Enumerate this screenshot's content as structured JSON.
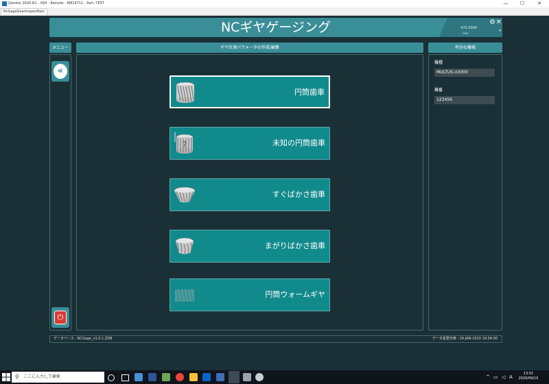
{
  "window": {
    "title": "Qandos 2020.R1 - X64 - Remote - RM14711 - Part: TEST",
    "tab": "NcGageGearInspecMain",
    "min": "—",
    "max": "☐",
    "close": "✕"
  },
  "header": {
    "title": "NCギヤゲージング",
    "value": "472.0000",
    "user": "User",
    "gear_glyph": "⚙",
    "close_glyph": "✕",
    "caret": "▾"
  },
  "menu": {
    "title": "メニュー",
    "back_glyph": "«",
    "exit_glyph": "⏻"
  },
  "main": {
    "title": "ギヤ計測パラメータの作成/編集",
    "buttons": [
      {
        "label": "円筒歯車",
        "icon": "cylindrical-gear-icon",
        "selected": true
      },
      {
        "label": "未知の円筒歯車",
        "icon": "unknown-cylindrical-gear-icon",
        "selected": false
      },
      {
        "label": "すぐばかさ歯車",
        "icon": "straight-bevel-gear-icon",
        "selected": false
      },
      {
        "label": "まがりばかさ歯車",
        "icon": "spiral-bevel-gear-icon",
        "selected": false
      },
      {
        "label": "円筒ウォームギヤ",
        "icon": "worm-gear-icon",
        "selected": false
      }
    ]
  },
  "right": {
    "title": "有効な機械",
    "machine_label": "機種",
    "machine_value": "MULTUS-U3000",
    "serial_label": "機番",
    "serial_value": "123456"
  },
  "status": {
    "database": "データベース : NCGage_v1.0.1.ZDB",
    "modified": "データ変更日時 : 24-JAN-2010 16:54:00"
  },
  "taskbar": {
    "search_placeholder": "ここに入力して検索",
    "search_glyph": "⚲",
    "time": "13:51",
    "date": "2020/09/10",
    "ime": "A"
  },
  "colors": {
    "app_bg": "#1b3036",
    "accent": "#3a8e98",
    "button_teal": "#118a8c",
    "exit_red": "#d73a2f"
  }
}
